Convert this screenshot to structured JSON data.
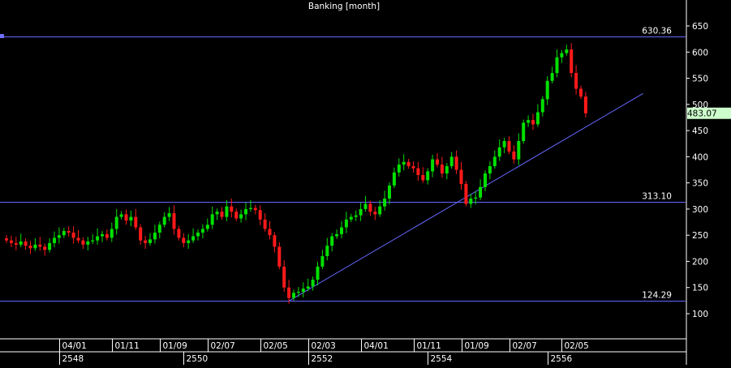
{
  "title": "Banking [month]",
  "chart_data": {
    "type": "candlestick",
    "title": "Banking [month]",
    "ylim": [
      75,
      680
    ],
    "y_ticks": [
      100,
      150,
      200,
      250,
      300,
      350,
      400,
      450,
      500,
      550,
      600,
      650
    ],
    "last_price": "483.07",
    "horizontal_lines": [
      {
        "value": 630.36,
        "label": "630.36"
      },
      {
        "value": 313.1,
        "label": "313.10"
      },
      {
        "value": 124.29,
        "label": "124.29"
      }
    ],
    "trendline": {
      "from_index": 59,
      "from_value": 124.29,
      "to_index": 133,
      "to_value": 521
    },
    "month_labels": [
      {
        "index": 11,
        "label": "04/01"
      },
      {
        "index": 22,
        "label": "01/11"
      },
      {
        "index": 32,
        "label": "01/09"
      },
      {
        "index": 42,
        "label": "02/07"
      },
      {
        "index": 53,
        "label": "02/05"
      },
      {
        "index": 63,
        "label": "02/03"
      },
      {
        "index": 74,
        "label": "04/01"
      },
      {
        "index": 85,
        "label": "01/11"
      },
      {
        "index": 95,
        "label": "01/09"
      },
      {
        "index": 105,
        "label": "02/07"
      },
      {
        "index": 116,
        "label": "02/05"
      }
    ],
    "year_labels": [
      {
        "index": 11,
        "label": "2548"
      },
      {
        "index": 37,
        "label": "2550"
      },
      {
        "index": 63,
        "label": "2552"
      },
      {
        "index": 88,
        "label": "2554"
      },
      {
        "index": 113,
        "label": "2556"
      }
    ],
    "close": [
      240,
      235,
      232,
      238,
      230,
      225,
      232,
      228,
      222,
      235,
      245,
      250,
      258,
      255,
      245,
      240,
      232,
      238,
      240,
      248,
      252,
      245,
      262,
      285,
      290,
      278,
      285,
      265,
      240,
      235,
      242,
      255,
      270,
      285,
      292,
      262,
      245,
      235,
      240,
      248,
      255,
      262,
      270,
      290,
      295,
      285,
      305,
      295,
      282,
      290,
      300,
      302,
      298,
      280,
      262,
      250,
      228,
      190,
      150,
      130,
      140,
      142,
      148,
      152,
      165,
      190,
      210,
      230,
      248,
      252,
      265,
      280,
      285,
      288,
      300,
      310,
      295,
      290,
      305,
      320,
      345,
      370,
      385,
      390,
      382,
      378,
      365,
      355,
      372,
      395,
      385,
      368,
      382,
      400,
      375,
      348,
      310,
      320,
      322,
      342,
      368,
      382,
      400,
      418,
      430,
      410,
      395,
      430,
      465,
      470,
      462,
      485,
      510,
      545,
      560,
      590,
      598,
      605,
      560,
      530,
      515,
      483
    ]
  }
}
